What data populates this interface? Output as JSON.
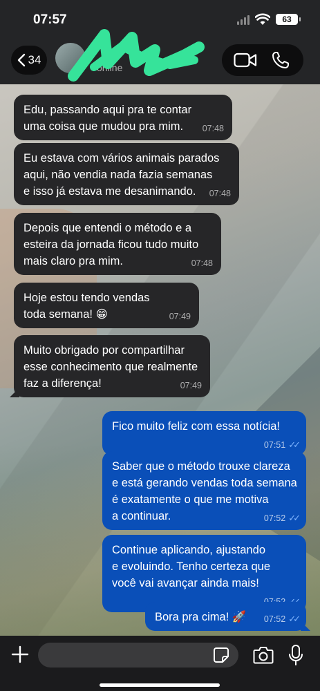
{
  "status_bar": {
    "time": "07:57",
    "battery": "63"
  },
  "header": {
    "back_count": "34",
    "contact_status": "online",
    "colors": {
      "header_bg": "#242527",
      "pill_bg": "#0d0d0e",
      "redaction": "#36e39a"
    }
  },
  "messages": [
    {
      "direction": "in",
      "text": "Edu, passando aqui pra te contar\numa coisa que mudou pra mim.",
      "time": "07:48"
    },
    {
      "direction": "in",
      "text": "Eu estava com vários animais parados\naqui, não vendia nada fazia semanas\ne isso já estava me desanimando.",
      "time": "07:48"
    },
    {
      "direction": "in",
      "text": "Depois que entendi o método e a\nesteira da jornada ficou tudo muito\nmais claro pra mim.",
      "time": "07:48"
    },
    {
      "direction": "in",
      "text": "Hoje estou tendo vendas\ntoda semana! 😁",
      "time": "07:49"
    },
    {
      "direction": "in",
      "text": "Muito obrigado por compartilhar\nesse conhecimento que realmente\nfaz a diferença!",
      "time": "07:49"
    },
    {
      "direction": "out",
      "text": "Fico muito feliz com essa notícia!",
      "time": "07:51",
      "ticks": "✓✓"
    },
    {
      "direction": "out",
      "text": "Saber que o método trouxe clareza\ne está gerando vendas toda semana\né exatamente o que me motiva\na continuar.",
      "time": "07:52",
      "ticks": "✓✓"
    },
    {
      "direction": "out",
      "text": "Continue aplicando, ajustando\ne evoluindo. Tenho certeza que\nvocê vai avançar ainda mais!",
      "time": "07:52",
      "ticks": "✓✓"
    },
    {
      "direction": "out",
      "text": "Bora pra cima! 🚀",
      "time": "07:52",
      "ticks": "✓✓"
    }
  ],
  "composer": {
    "placeholder": ""
  },
  "colors": {
    "incoming_bubble": "#262628",
    "outgoing_bubble": "#0a4fb8",
    "read_ticks": "#7fb5ff"
  }
}
